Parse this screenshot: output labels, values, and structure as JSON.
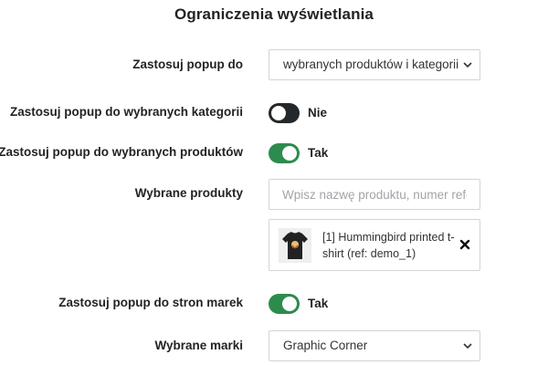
{
  "title": "Ograniczenia wyświetlania",
  "apply_to": {
    "label": "Zastosuj popup do",
    "value": "wybranych produktów i kategorii"
  },
  "categories": {
    "label": "Zastosuj popup do wybranych kategorii",
    "state": "Nie"
  },
  "products": {
    "label": "Zastosuj popup do wybranych produktów",
    "state": "Tak"
  },
  "selected_products": {
    "label": "Wybrane produkty",
    "placeholder": "Wpisz nazwę produktu, numer referencyjny",
    "items": [
      {
        "name": "[1] Hummingbird printed t-shirt (ref: demo_1)"
      }
    ]
  },
  "brands": {
    "label": "Zastosuj popup do stron marek",
    "state": "Tak"
  },
  "selected_brands": {
    "label": "Wybrane marki",
    "value": "Graphic Corner"
  },
  "colors": {
    "toggle_on": "#2e8b4e",
    "toggle_off": "#25282a"
  },
  "icons": {
    "select_arrow": "chevron-down-icon",
    "remove": "close-icon",
    "product_image": "tshirt-thumbnail"
  }
}
